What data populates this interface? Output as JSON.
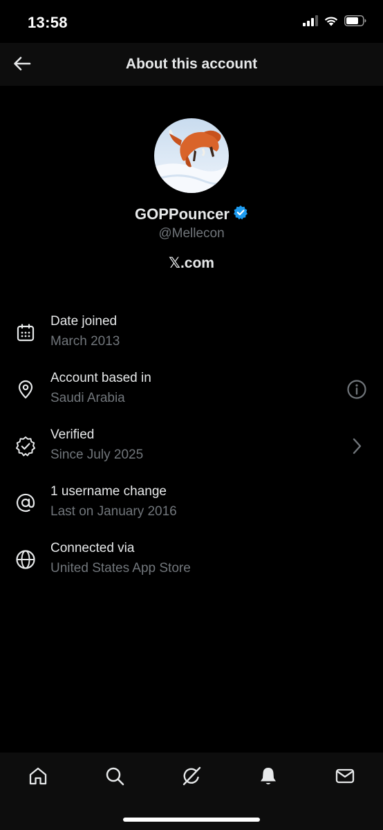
{
  "status_bar": {
    "time": "13:58"
  },
  "header": {
    "title": "About this account",
    "back_icon": "arrow-left-icon"
  },
  "profile": {
    "display_name": "GOPPouncer",
    "verified_badge_color": "#1d9bf0",
    "handle": "@Mellecon",
    "source": "𝕏.com"
  },
  "info_rows": [
    {
      "icon": "calendar-icon",
      "title": "Date joined",
      "subtitle": "March 2013",
      "trailing": ""
    },
    {
      "icon": "location-pin-icon",
      "title": "Account based in",
      "subtitle": "Saudi Arabia",
      "trailing": "info-icon"
    },
    {
      "icon": "verified-badge-icon",
      "title": "Verified",
      "subtitle": "Since July 2025",
      "trailing": "chevron-right-icon"
    },
    {
      "icon": "at-sign-icon",
      "title": "1 username change",
      "subtitle": "Last on January 2016",
      "trailing": ""
    },
    {
      "icon": "globe-icon",
      "title": "Connected via",
      "subtitle": "United States App Store",
      "trailing": ""
    }
  ],
  "bottom_nav": {
    "items": [
      "home-icon",
      "search-icon",
      "grok-icon",
      "notifications-icon",
      "messages-icon"
    ]
  },
  "colors": {
    "background": "#000000",
    "bar_background": "#0d0d0d",
    "primary_text": "#e7e9ea",
    "secondary_text": "#71767b",
    "accent": "#1d9bf0"
  }
}
